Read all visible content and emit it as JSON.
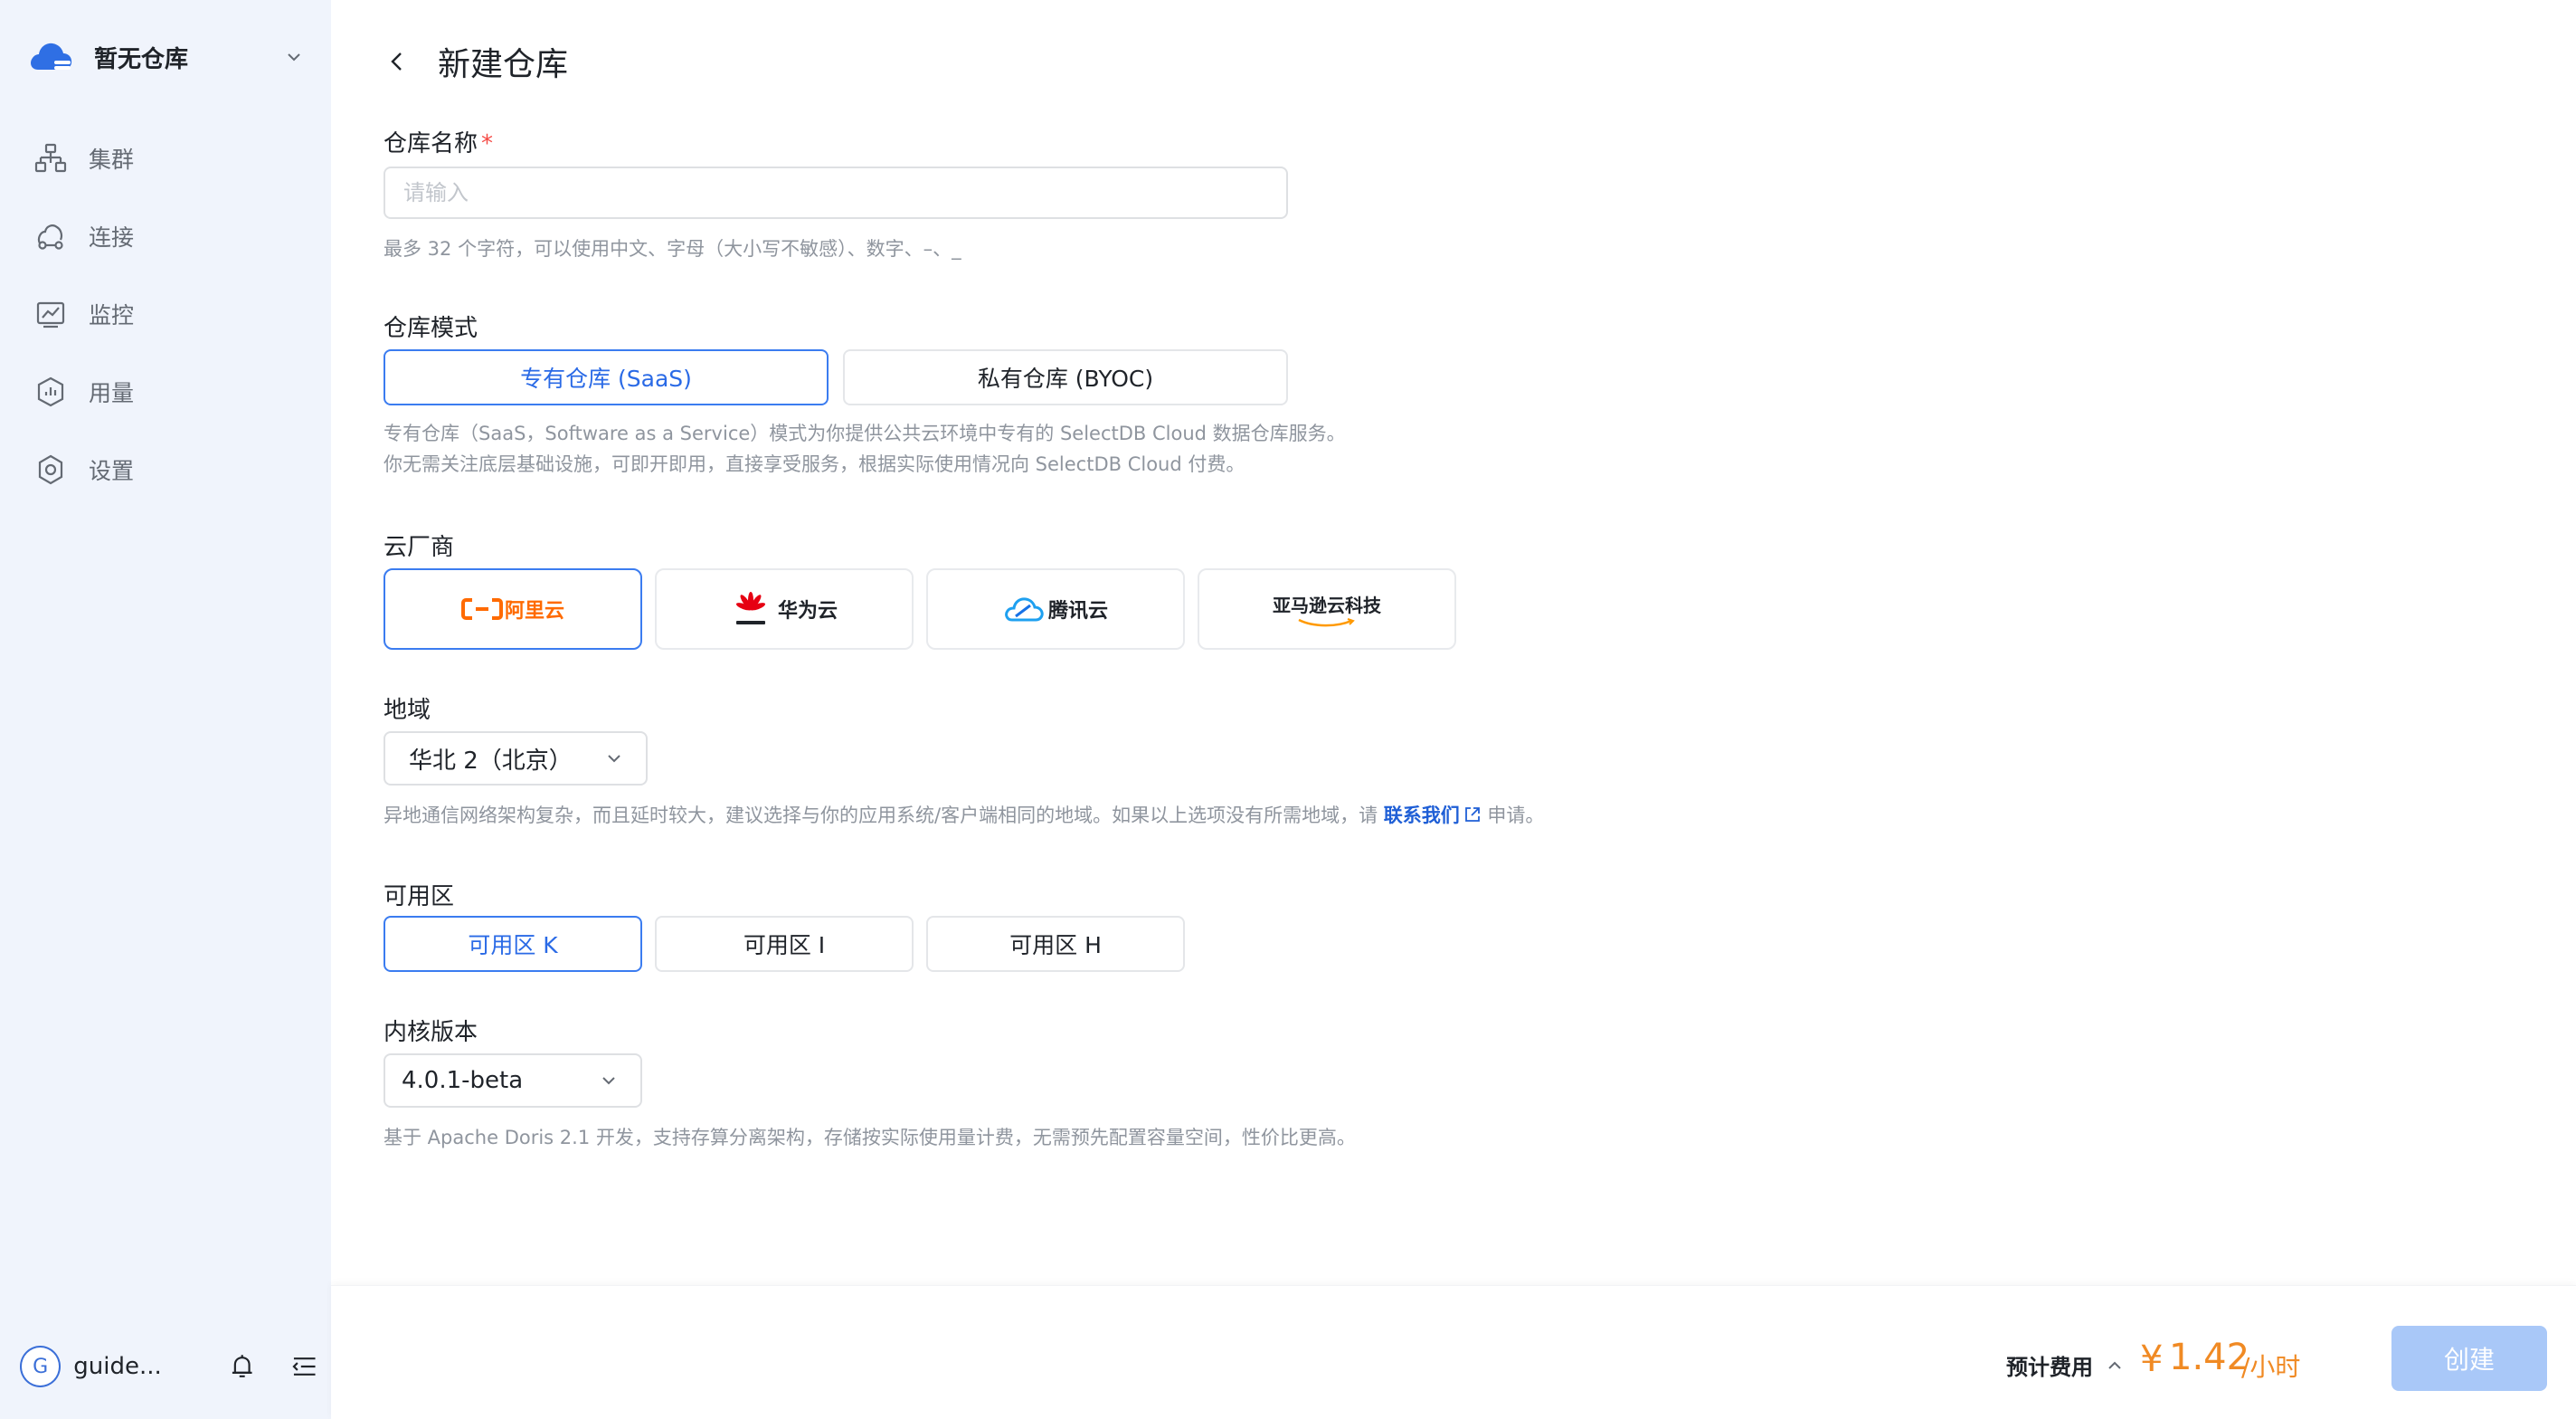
{
  "sidebar": {
    "workspace": "暂无仓库",
    "items": [
      {
        "label": "集群",
        "icon": "cluster-icon"
      },
      {
        "label": "连接",
        "icon": "connect-icon"
      },
      {
        "label": "监控",
        "icon": "monitor-icon"
      },
      {
        "label": "用量",
        "icon": "usage-icon"
      },
      {
        "label": "设置",
        "icon": "settings-icon"
      }
    ],
    "avatar_letter": "G",
    "user": "guide...",
    "accent": "#3b6fd8"
  },
  "header": {
    "title": "新建仓库"
  },
  "form": {
    "name": {
      "label": "仓库名称",
      "required_mark": "*",
      "placeholder": "请输入",
      "value": "",
      "help": "最多 32 个字符，可以使用中文、字母（大小写不敏感）、数字、–、_"
    },
    "mode": {
      "label": "仓库模式",
      "options": [
        "专有仓库 (SaaS)",
        "私有仓库 (BYOC)"
      ],
      "selected": "专有仓库 (SaaS)",
      "help_line1": "专有仓库（SaaS，Software as a Service）模式为你提供公共云环境中专有的 SelectDB Cloud 数据仓库服务。",
      "help_line2": "你无需关注底层基础设施，可即开即用，直接享受服务，根据实际使用情况向 SelectDB Cloud 付费。"
    },
    "provider": {
      "label": "云厂商",
      "options": [
        {
          "name": "阿里云",
          "icon": "aliyun-logo-icon"
        },
        {
          "name": "华为云",
          "icon": "huawei-logo-icon"
        },
        {
          "name": "腾讯云",
          "icon": "tencent-cloud-logo-icon"
        },
        {
          "name": "亚马逊云科技",
          "icon": "aws-logo-icon"
        }
      ],
      "selected": "阿里云"
    },
    "region": {
      "label": "地域",
      "value": "华北 2（北京）",
      "help_prefix": "异地通信网络架构复杂，而且延时较大，建议选择与你的应用系统/客户端相同的地域。如果以上选项没有所需地域，请 ",
      "help_link": "联系我们",
      "help_suffix": " 申请。"
    },
    "zone": {
      "label": "可用区",
      "options": [
        "可用区 K",
        "可用区 I",
        "可用区 H"
      ],
      "selected": "可用区 K"
    },
    "version": {
      "label": "内核版本",
      "value": "4.0.1-beta",
      "help": "基于 Apache Doris 2.1 开发，支持存算分离架构，存储按实际使用量计费，无需预先配置容量空间，性价比更高。"
    }
  },
  "footer": {
    "cost_label": "预计费用",
    "currency": "¥",
    "cost_value": "1.42",
    "cost_unit": "/小时",
    "create_label": "创建",
    "cost_color": "#f08a24"
  }
}
